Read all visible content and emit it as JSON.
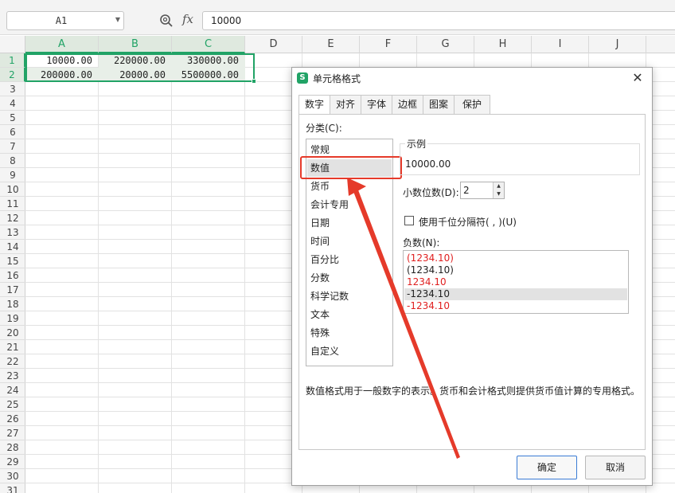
{
  "formula_bar": {
    "name_box": "A1",
    "zoom_icon": "zoom-icon",
    "fx_label": "fx",
    "formula_value": "10000"
  },
  "sheet": {
    "columns": [
      "A",
      "B",
      "C",
      "D",
      "E",
      "F",
      "G",
      "H",
      "I",
      "J"
    ],
    "rows": [
      "1",
      "2",
      "3",
      "4",
      "5",
      "6",
      "7",
      "8",
      "9",
      "10",
      "11",
      "12",
      "13",
      "14",
      "15",
      "16",
      "17",
      "18",
      "19",
      "20",
      "21",
      "22",
      "23",
      "24",
      "25",
      "26",
      "27",
      "28",
      "29",
      "30",
      "31"
    ],
    "cells": [
      [
        "10000.00",
        "220000.00",
        "330000.00"
      ],
      [
        "200000.00",
        "20000.00",
        "5500000.00"
      ]
    ],
    "accent_color": "#21a366"
  },
  "dialog": {
    "title": "单元格格式",
    "close_icon": "close-icon",
    "tabs": [
      "数字",
      "对齐",
      "字体",
      "边框",
      "图案",
      "保护"
    ],
    "active_tab": "数字",
    "category_label": "分类(C):",
    "categories": [
      "常规",
      "数值",
      "货币",
      "会计专用",
      "日期",
      "时间",
      "百分比",
      "分数",
      "科学记数",
      "文本",
      "特殊",
      "自定义"
    ],
    "selected_category": "数值",
    "sample_label": "示例",
    "sample_value": "10000.00",
    "decimal_label": "小数位数(D):",
    "decimal_value": "2",
    "thousand_sep_label": "使用千位分隔符( , )(U)",
    "thousand_sep_checked": false,
    "negative_label": "负数(N):",
    "negative_options": [
      {
        "text": "(1234.10)",
        "color": "#e02020"
      },
      {
        "text": "(1234.10)",
        "color": "#222222"
      },
      {
        "text": "1234.10",
        "color": "#e02020"
      },
      {
        "text": "-1234.10",
        "color": "#222222"
      },
      {
        "text": "-1234.10",
        "color": "#e02020"
      }
    ],
    "selected_negative_index": 3,
    "description": "数值格式用于一般数字的表示。货币和会计格式则提供货币值计算的专用格式。",
    "ok_label": "确定",
    "cancel_label": "取消",
    "highlight_color": "#e53a2a"
  }
}
